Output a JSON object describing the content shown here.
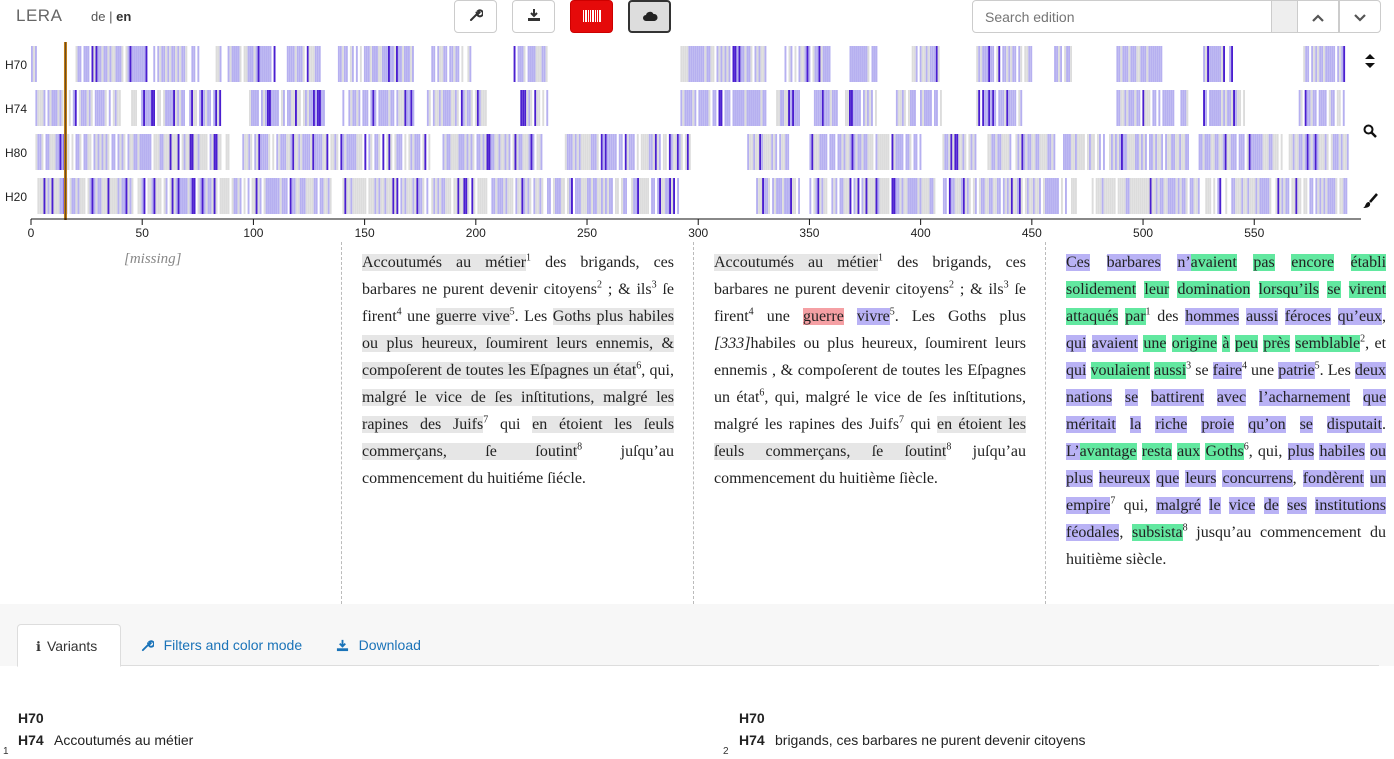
{
  "app": {
    "title": "LERA",
    "lang_de": "de",
    "lang_sep": "|",
    "lang_en": "en"
  },
  "toolbar": {
    "tools_icon": "wrench-icon",
    "download_icon": "download-icon",
    "barcode_icon": "barcode-icon",
    "cloud_icon": "cloud-icon"
  },
  "search": {
    "placeholder": "Search edition",
    "prev_icon": "chevron-up-icon",
    "next_icon": "chevron-down-icon"
  },
  "overview": {
    "rows": [
      "H70",
      "H74",
      "H80",
      "H20"
    ],
    "axis_ticks": [
      "0",
      "50",
      "100",
      "150",
      "200",
      "250",
      "300",
      "350",
      "400",
      "450",
      "500",
      "550"
    ],
    "axis_max": 598,
    "cursor_position": 15.5,
    "colors": {
      "purple_dark": "#4a1fd0",
      "purple_light": "#b6b0f0",
      "gray": "#dcdcdc",
      "cursor": "#c07a12"
    },
    "side_icons": [
      "sort-icon",
      "search-icon",
      "brush-icon"
    ]
  },
  "columns": {
    "col1": {
      "missing": "[missing]"
    }
  },
  "tabs": {
    "variants": "Variants",
    "filters": "Filters and color mode",
    "download": "Download"
  },
  "variants": {
    "left": {
      "num": "1",
      "h70": "H70",
      "h74": "H74",
      "h74_text": "Accoutumés au métier"
    },
    "right": {
      "num": "2",
      "h70": "H70",
      "h74": "H74",
      "h74_text": "brigands, ces barbares ne purent devenir citoyens"
    }
  }
}
